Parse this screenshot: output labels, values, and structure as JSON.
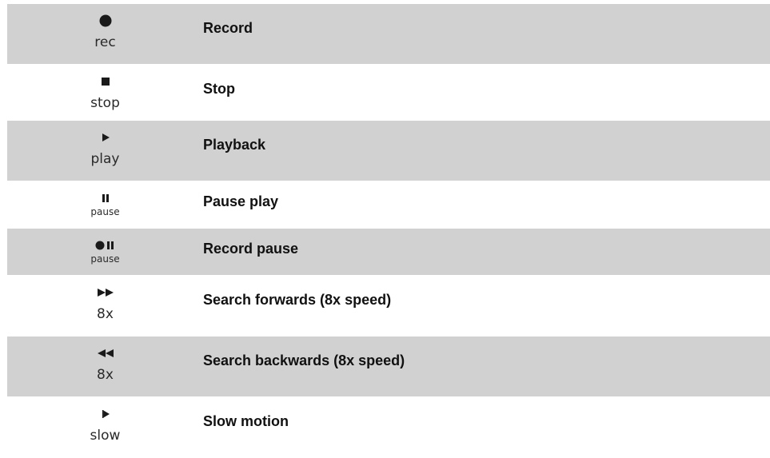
{
  "rows": [
    {
      "icon": "record-dot-icon",
      "sublabel": "rec",
      "label": "Record"
    },
    {
      "icon": "stop-square-icon",
      "sublabel": "stop",
      "label": "Stop"
    },
    {
      "icon": "play-triangle-icon",
      "sublabel": "play",
      "label": "Playback"
    },
    {
      "icon": "pause-bars-icon",
      "sublabel": "pause",
      "label": "Pause play"
    },
    {
      "icon": "record-pause-icon",
      "sublabel": "pause",
      "label": "Record pause"
    },
    {
      "icon": "fast-forward-icon",
      "sublabel": "8x",
      "label": "Search forwards (8x speed)"
    },
    {
      "icon": "rewind-icon",
      "sublabel": "8x",
      "label": "Search backwards (8x speed)"
    },
    {
      "icon": "slow-motion-icon",
      "sublabel": "slow",
      "label": "Slow motion"
    }
  ]
}
